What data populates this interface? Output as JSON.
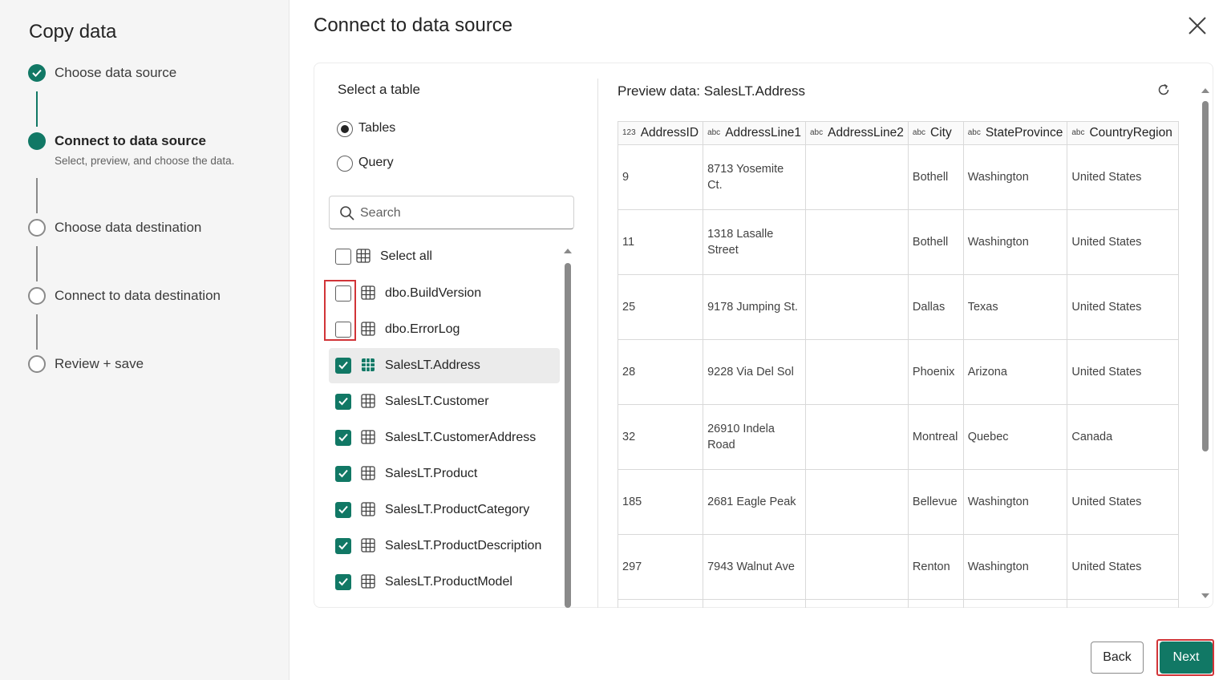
{
  "sidebar": {
    "title": "Copy data",
    "steps": [
      {
        "label": "Choose data source",
        "state": "done"
      },
      {
        "label": "Connect to data source",
        "state": "current",
        "sub": "Select, preview, and choose the data."
      },
      {
        "label": "Choose data destination",
        "state": "todo"
      },
      {
        "label": "Connect to data destination",
        "state": "todo"
      },
      {
        "label": "Review + save",
        "state": "todo"
      }
    ]
  },
  "main": {
    "title": "Connect to data source",
    "select_title": "Select a table",
    "radio": {
      "tables_label": "Tables",
      "query_label": "Query",
      "selected": "Tables"
    },
    "search": {
      "placeholder": "Search",
      "value": ""
    },
    "select_all_label": "Select all",
    "tables": [
      {
        "name": "dbo.BuildVersion",
        "checked": false
      },
      {
        "name": "dbo.ErrorLog",
        "checked": false
      },
      {
        "name": "SalesLT.Address",
        "checked": true,
        "selected": true
      },
      {
        "name": "SalesLT.Customer",
        "checked": true
      },
      {
        "name": "SalesLT.CustomerAddress",
        "checked": true
      },
      {
        "name": "SalesLT.Product",
        "checked": true
      },
      {
        "name": "SalesLT.ProductCategory",
        "checked": true
      },
      {
        "name": "SalesLT.ProductDescription",
        "checked": true
      },
      {
        "name": "SalesLT.ProductModel",
        "checked": true
      }
    ],
    "preview": {
      "title": "Preview data: SalesLT.Address",
      "columns": [
        {
          "type": "123",
          "name": "AddressID"
        },
        {
          "type": "abc",
          "name": "AddressLine1"
        },
        {
          "type": "abc",
          "name": "AddressLine2"
        },
        {
          "type": "abc",
          "name": "City"
        },
        {
          "type": "abc",
          "name": "StateProvince"
        },
        {
          "type": "abc",
          "name": "CountryRegion"
        }
      ],
      "rows": [
        [
          "9",
          "8713 Yosemite Ct.",
          "",
          "Bothell",
          "Washington",
          "United States"
        ],
        [
          "11",
          "1318 Lasalle Street",
          "",
          "Bothell",
          "Washington",
          "United States"
        ],
        [
          "25",
          "9178 Jumping St.",
          "",
          "Dallas",
          "Texas",
          "United States"
        ],
        [
          "28",
          "9228 Via Del Sol",
          "",
          "Phoenix",
          "Arizona",
          "United States"
        ],
        [
          "32",
          "26910 Indela Road",
          "",
          "Montreal",
          "Quebec",
          "Canada"
        ],
        [
          "185",
          "2681 Eagle Peak",
          "",
          "Bellevue",
          "Washington",
          "United States"
        ],
        [
          "297",
          "7943 Walnut Ave",
          "",
          "Renton",
          "Washington",
          "United States"
        ],
        [
          "",
          "",
          "",
          "",
          "",
          ""
        ]
      ]
    },
    "buttons": {
      "back": "Back",
      "next": "Next"
    }
  },
  "colors": {
    "accent": "#117865",
    "highlight": "#d13438"
  }
}
